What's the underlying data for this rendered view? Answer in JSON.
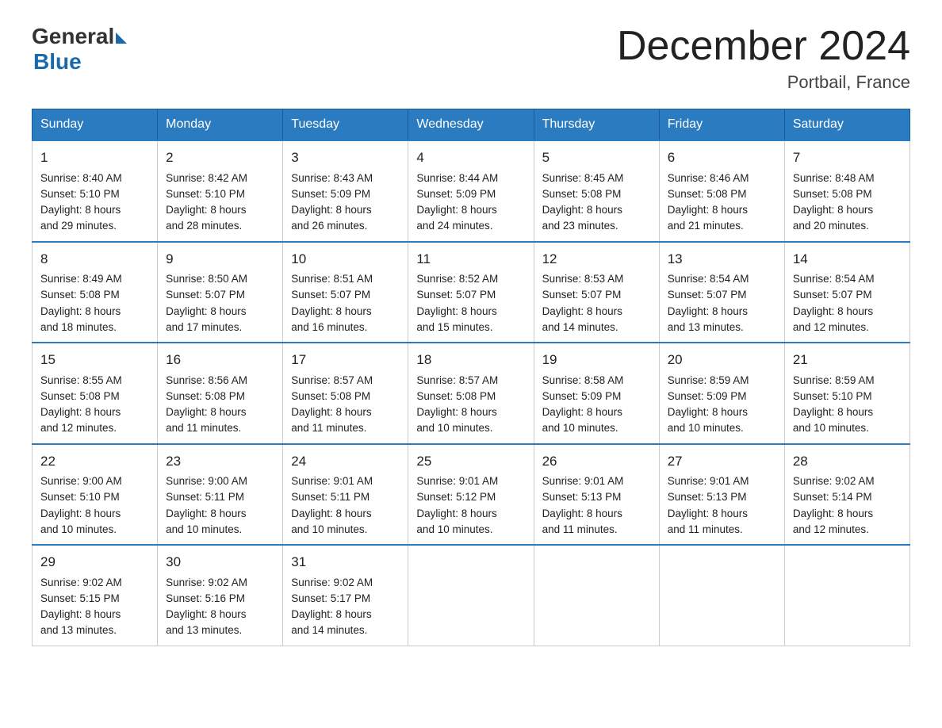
{
  "logo": {
    "general": "General",
    "blue": "Blue"
  },
  "title": "December 2024",
  "location": "Portbail, France",
  "days_of_week": [
    "Sunday",
    "Monday",
    "Tuesday",
    "Wednesday",
    "Thursday",
    "Friday",
    "Saturday"
  ],
  "weeks": [
    [
      {
        "day": "1",
        "sunrise": "8:40 AM",
        "sunset": "5:10 PM",
        "daylight": "8 hours and 29 minutes."
      },
      {
        "day": "2",
        "sunrise": "8:42 AM",
        "sunset": "5:10 PM",
        "daylight": "8 hours and 28 minutes."
      },
      {
        "day": "3",
        "sunrise": "8:43 AM",
        "sunset": "5:09 PM",
        "daylight": "8 hours and 26 minutes."
      },
      {
        "day": "4",
        "sunrise": "8:44 AM",
        "sunset": "5:09 PM",
        "daylight": "8 hours and 24 minutes."
      },
      {
        "day": "5",
        "sunrise": "8:45 AM",
        "sunset": "5:08 PM",
        "daylight": "8 hours and 23 minutes."
      },
      {
        "day": "6",
        "sunrise": "8:46 AM",
        "sunset": "5:08 PM",
        "daylight": "8 hours and 21 minutes."
      },
      {
        "day": "7",
        "sunrise": "8:48 AM",
        "sunset": "5:08 PM",
        "daylight": "8 hours and 20 minutes."
      }
    ],
    [
      {
        "day": "8",
        "sunrise": "8:49 AM",
        "sunset": "5:08 PM",
        "daylight": "8 hours and 18 minutes."
      },
      {
        "day": "9",
        "sunrise": "8:50 AM",
        "sunset": "5:07 PM",
        "daylight": "8 hours and 17 minutes."
      },
      {
        "day": "10",
        "sunrise": "8:51 AM",
        "sunset": "5:07 PM",
        "daylight": "8 hours and 16 minutes."
      },
      {
        "day": "11",
        "sunrise": "8:52 AM",
        "sunset": "5:07 PM",
        "daylight": "8 hours and 15 minutes."
      },
      {
        "day": "12",
        "sunrise": "8:53 AM",
        "sunset": "5:07 PM",
        "daylight": "8 hours and 14 minutes."
      },
      {
        "day": "13",
        "sunrise": "8:54 AM",
        "sunset": "5:07 PM",
        "daylight": "8 hours and 13 minutes."
      },
      {
        "day": "14",
        "sunrise": "8:54 AM",
        "sunset": "5:07 PM",
        "daylight": "8 hours and 12 minutes."
      }
    ],
    [
      {
        "day": "15",
        "sunrise": "8:55 AM",
        "sunset": "5:08 PM",
        "daylight": "8 hours and 12 minutes."
      },
      {
        "day": "16",
        "sunrise": "8:56 AM",
        "sunset": "5:08 PM",
        "daylight": "8 hours and 11 minutes."
      },
      {
        "day": "17",
        "sunrise": "8:57 AM",
        "sunset": "5:08 PM",
        "daylight": "8 hours and 11 minutes."
      },
      {
        "day": "18",
        "sunrise": "8:57 AM",
        "sunset": "5:08 PM",
        "daylight": "8 hours and 10 minutes."
      },
      {
        "day": "19",
        "sunrise": "8:58 AM",
        "sunset": "5:09 PM",
        "daylight": "8 hours and 10 minutes."
      },
      {
        "day": "20",
        "sunrise": "8:59 AM",
        "sunset": "5:09 PM",
        "daylight": "8 hours and 10 minutes."
      },
      {
        "day": "21",
        "sunrise": "8:59 AM",
        "sunset": "5:10 PM",
        "daylight": "8 hours and 10 minutes."
      }
    ],
    [
      {
        "day": "22",
        "sunrise": "9:00 AM",
        "sunset": "5:10 PM",
        "daylight": "8 hours and 10 minutes."
      },
      {
        "day": "23",
        "sunrise": "9:00 AM",
        "sunset": "5:11 PM",
        "daylight": "8 hours and 10 minutes."
      },
      {
        "day": "24",
        "sunrise": "9:01 AM",
        "sunset": "5:11 PM",
        "daylight": "8 hours and 10 minutes."
      },
      {
        "day": "25",
        "sunrise": "9:01 AM",
        "sunset": "5:12 PM",
        "daylight": "8 hours and 10 minutes."
      },
      {
        "day": "26",
        "sunrise": "9:01 AM",
        "sunset": "5:13 PM",
        "daylight": "8 hours and 11 minutes."
      },
      {
        "day": "27",
        "sunrise": "9:01 AM",
        "sunset": "5:13 PM",
        "daylight": "8 hours and 11 minutes."
      },
      {
        "day": "28",
        "sunrise": "9:02 AM",
        "sunset": "5:14 PM",
        "daylight": "8 hours and 12 minutes."
      }
    ],
    [
      {
        "day": "29",
        "sunrise": "9:02 AM",
        "sunset": "5:15 PM",
        "daylight": "8 hours and 13 minutes."
      },
      {
        "day": "30",
        "sunrise": "9:02 AM",
        "sunset": "5:16 PM",
        "daylight": "8 hours and 13 minutes."
      },
      {
        "day": "31",
        "sunrise": "9:02 AM",
        "sunset": "5:17 PM",
        "daylight": "8 hours and 14 minutes."
      },
      null,
      null,
      null,
      null
    ]
  ],
  "labels": {
    "sunrise": "Sunrise:",
    "sunset": "Sunset:",
    "daylight": "Daylight:"
  }
}
